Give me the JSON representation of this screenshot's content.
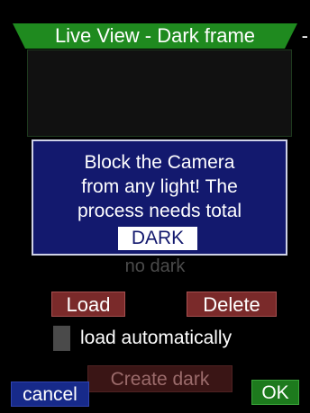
{
  "colors": {
    "title_bar": "#1f8a1f",
    "dialog_bg": "#13196e",
    "button_red": "#7a2a2a",
    "cancel_blue": "#172a8a",
    "ok_green": "#1d7a1d",
    "checkbox": "#4a4a4a"
  },
  "header": {
    "title": "Live View - Dark frame",
    "dash": "-"
  },
  "dialog": {
    "lines": [
      "Block the Camera",
      "from any light! The",
      "process needs total"
    ],
    "highlight": "DARK"
  },
  "status": {
    "text": "no dark"
  },
  "buttons": {
    "load": "Load",
    "delete": "Delete",
    "create": "Create dark",
    "cancel": "cancel",
    "ok": "OK"
  },
  "options": {
    "load_auto_label": "load automatically",
    "load_auto_checked": false
  }
}
